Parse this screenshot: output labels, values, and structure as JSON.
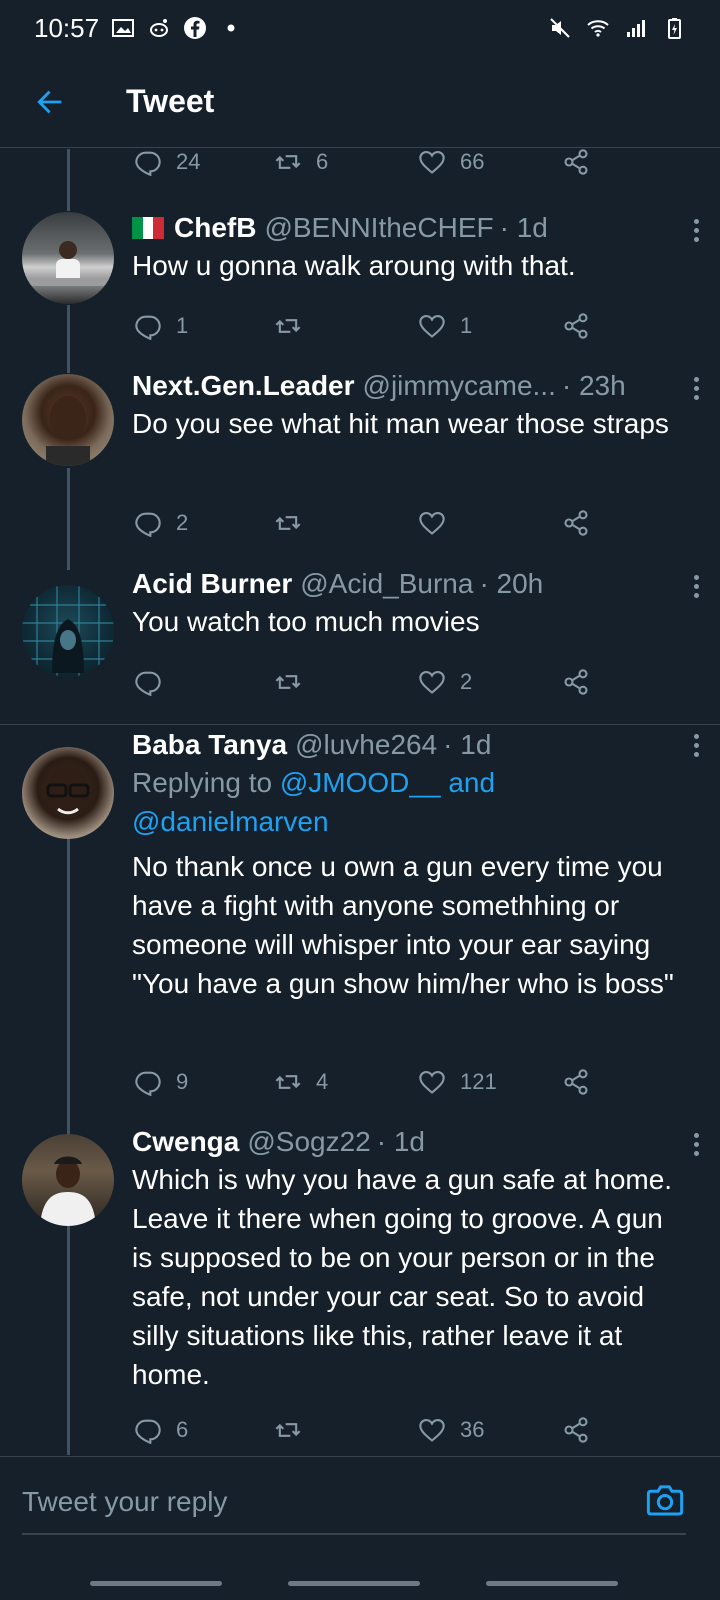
{
  "status_bar": {
    "time": "10:57"
  },
  "app_bar": {
    "title": "Tweet",
    "back_icon": "arrow-left-icon"
  },
  "colors": {
    "background": "#15202b",
    "accent": "#1da1f2",
    "muted": "#8899a6",
    "divider": "#38444d"
  },
  "prev_tweet_actions": {
    "replies": "24",
    "retweets": "6",
    "likes": "66"
  },
  "tweets": [
    {
      "name": "ChefB",
      "handle": "@BENNItheCHEF",
      "time": "· 1d",
      "flag": "italy",
      "text": "How u gonna walk aroung with that.",
      "replies": "1",
      "retweets": "",
      "likes": "1"
    },
    {
      "name": "Next.Gen.Leader",
      "handle": "@jimmycame...",
      "time": "· 23h",
      "text": "Do you see what hit man wear those straps",
      "replies": "2",
      "retweets": "",
      "likes": ""
    },
    {
      "name": "Acid Burner",
      "handle": "@Acid_Burna",
      "time": "· 20h",
      "text": "You watch too much movies",
      "replies": "",
      "retweets": "",
      "likes": "2"
    },
    {
      "name": "Baba Tanya",
      "handle": "@luvhe264",
      "time": "· 1d",
      "replying_prefix": "Replying to",
      "replying_to": "@JMOOD__ and @danielmarven",
      "text": "No thank once u own a gun every time you have a fight with anyone somethhing or someone will whisper into your ear saying \"You have a gun show him/her who is boss\"",
      "replies": "9",
      "retweets": "4",
      "likes": "121"
    },
    {
      "name": "Cwenga",
      "handle": "@Sogz22",
      "time": "· 1d",
      "text": "Which is why you have a gun safe at home. Leave it there when going to groove. A gun is supposed to be on your person or in the safe, not under your car seat. So to avoid silly situations like this, rather leave it at home.",
      "replies": "6",
      "retweets": "",
      "likes": "36"
    }
  ],
  "reply_bar": {
    "placeholder": "Tweet your reply",
    "camera_icon": "camera-icon"
  }
}
